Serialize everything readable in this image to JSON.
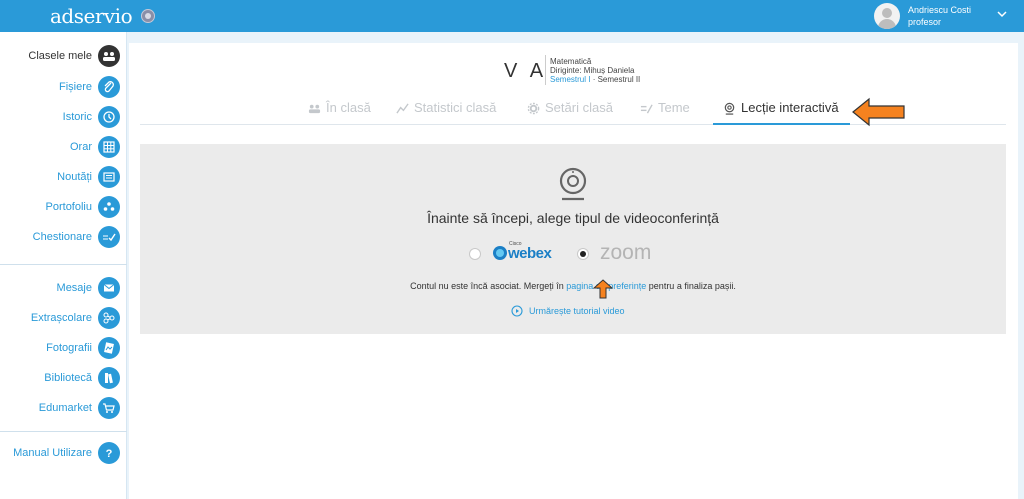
{
  "app": {
    "logo_text": "adservio",
    "brand_color": "#2a9ad8",
    "flag_icon": "language-flag-icon"
  },
  "user": {
    "name": "Andriescu Costi",
    "role": "profesor"
  },
  "sidebar": {
    "items": [
      {
        "label": "Clasele mele",
        "icon": "class-group-icon"
      },
      {
        "label": "Fișiere",
        "icon": "paperclip-icon"
      },
      {
        "label": "Istoric",
        "icon": "history-icon"
      },
      {
        "label": "Orar",
        "icon": "calendar-grid-icon"
      },
      {
        "label": "Noutăți",
        "icon": "news-icon"
      },
      {
        "label": "Portofoliu",
        "icon": "portfolio-icon"
      },
      {
        "label": "Chestionare",
        "icon": "checklist-icon"
      },
      {
        "label": "Mesaje",
        "icon": "envelope-icon"
      },
      {
        "label": "Extrașcolare",
        "icon": "activities-icon"
      },
      {
        "label": "Fotografii",
        "icon": "photo-icon"
      },
      {
        "label": "Bibliotecă",
        "icon": "book-icon"
      },
      {
        "label": "Edumarket",
        "icon": "cart-icon"
      },
      {
        "label": "Manual Utilizare",
        "icon": "question-icon"
      }
    ]
  },
  "class_header": {
    "name": "V A",
    "subject": "Matematică",
    "homeroom": "Diriginte: Mihuș Daniela",
    "semester_1": "Semestrul I",
    "semester_sep": " · ",
    "semester_2": "Semestrul II"
  },
  "tabs": [
    {
      "label": "În clasă",
      "icon": "class-group-icon"
    },
    {
      "label": "Statistici clasă",
      "icon": "chart-line-icon"
    },
    {
      "label": "Setări clasă",
      "icon": "gear-icon"
    },
    {
      "label": "Teme",
      "icon": "homework-icon"
    },
    {
      "label": "Lecție interactivă",
      "icon": "webcam-icon",
      "active": true
    }
  ],
  "conference": {
    "title": "Înainte să începi, alege tipul de videoconferință",
    "options": [
      {
        "label": "webex",
        "sublabel": "Cisco",
        "selected": false
      },
      {
        "label": "zoom",
        "selected": true
      }
    ],
    "message_prefix": "Contul nu este încă asociat. Mergeți în ",
    "message_link": "pagina de preferințe",
    "message_suffix": " pentru a finaliza pașii.",
    "tutorial_link": "Urmărește tutorial video"
  },
  "annotations": {
    "arrow_color": "#f5821f"
  }
}
